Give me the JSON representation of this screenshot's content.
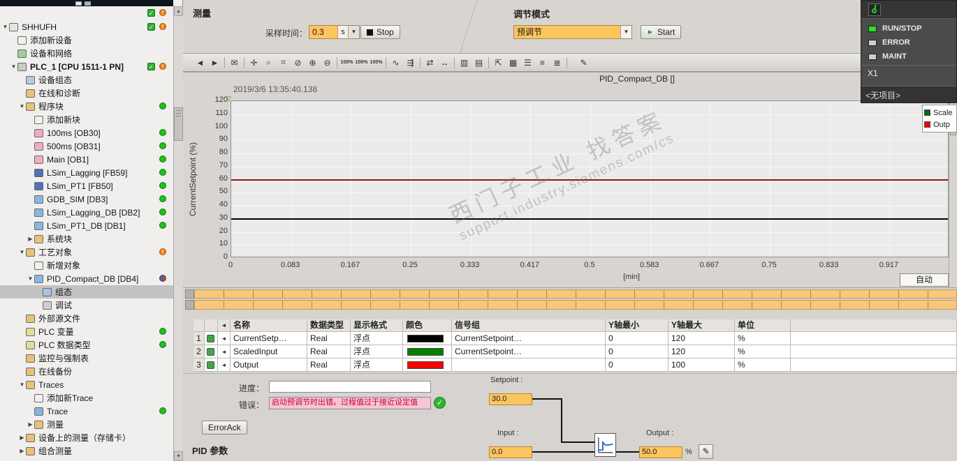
{
  "sidebar": {
    "items": [
      {
        "label": "SHHUFH",
        "level": 0,
        "arrow": "down",
        "icon": "project",
        "status": [
          "check",
          "warn"
        ]
      },
      {
        "label": "添加新设备",
        "level": 1,
        "icon": "add-device"
      },
      {
        "label": "设备和网络",
        "level": 1,
        "icon": "network"
      },
      {
        "label": "PLC_1 [CPU 1511-1 PN]",
        "level": 1,
        "arrow": "down",
        "icon": "plc",
        "status": [
          "check",
          "warn"
        ],
        "bold": true
      },
      {
        "label": "设备组态",
        "level": 2,
        "icon": "device-config"
      },
      {
        "label": "在线和诊断",
        "level": 2,
        "icon": "diagnostics"
      },
      {
        "label": "程序块",
        "level": 2,
        "arrow": "down",
        "icon": "folder-blocks",
        "status": [
          "green"
        ]
      },
      {
        "label": "添加新块",
        "level": 3,
        "icon": "add-block"
      },
      {
        "label": "100ms [OB30]",
        "level": 3,
        "icon": "ob",
        "status": [
          "green"
        ]
      },
      {
        "label": "500ms [OB31]",
        "level": 3,
        "icon": "ob",
        "status": [
          "green"
        ]
      },
      {
        "label": "Main [OB1]",
        "level": 3,
        "icon": "ob",
        "status": [
          "green"
        ]
      },
      {
        "label": "LSim_Lagging [FB59]",
        "level": 3,
        "icon": "fb",
        "status": [
          "green"
        ]
      },
      {
        "label": "LSim_PT1 [FB50]",
        "level": 3,
        "icon": "fb",
        "status": [
          "green"
        ]
      },
      {
        "label": "GDB_SIM [DB3]",
        "level": 3,
        "icon": "db",
        "status": [
          "green"
        ]
      },
      {
        "label": "LSim_Lagging_DB [DB2]",
        "level": 3,
        "icon": "db",
        "status": [
          "green"
        ]
      },
      {
        "label": "LSim_PT1_DB [DB1]",
        "level": 3,
        "icon": "db",
        "status": [
          "green"
        ]
      },
      {
        "label": "系统块",
        "level": 3,
        "arrow": "right",
        "icon": "folder-system"
      },
      {
        "label": "工艺对象",
        "level": 2,
        "arrow": "down",
        "icon": "folder-tech",
        "status": [
          "warn"
        ]
      },
      {
        "label": "新增对象",
        "level": 3,
        "icon": "add-object"
      },
      {
        "label": "PID_Compact_DB [DB4]",
        "level": 3,
        "arrow": "down",
        "icon": "pid-db",
        "status": [
          "half"
        ]
      },
      {
        "label": "组态",
        "level": 4,
        "icon": "config",
        "selected": true
      },
      {
        "label": "调试",
        "level": 4,
        "icon": "commissioning"
      },
      {
        "label": "外部源文件",
        "level": 2,
        "icon": "folder-ext"
      },
      {
        "label": "PLC 变量",
        "level": 2,
        "icon": "tags",
        "status": [
          "green"
        ]
      },
      {
        "label": "PLC 数据类型",
        "level": 2,
        "icon": "data-types",
        "status": [
          "green"
        ]
      },
      {
        "label": "监控与强制表",
        "level": 2,
        "icon": "folder-watch"
      },
      {
        "label": "在线备份",
        "level": 2,
        "icon": "folder-backup"
      },
      {
        "label": "Traces",
        "level": 2,
        "arrow": "down",
        "icon": "folder-traces"
      },
      {
        "label": "添加新Trace",
        "level": 3,
        "icon": "add-trace"
      },
      {
        "label": "Trace",
        "level": 3,
        "icon": "trace",
        "status": [
          "green"
        ]
      },
      {
        "label": "测量",
        "level": 3,
        "arrow": "right",
        "icon": "folder-meas"
      },
      {
        "label": "设备上的测量（存储卡）",
        "level": 2,
        "arrow": "right",
        "icon": "folder-card"
      },
      {
        "label": "组合测量",
        "level": 2,
        "arrow": "right",
        "icon": "folder-multi"
      }
    ]
  },
  "header": {
    "measure_title": "测量",
    "sampling_label": "采样时间：",
    "sampling_value": "0.3",
    "sampling_unit": "s",
    "stop_label": "Stop",
    "tuning_title": "调节模式",
    "tuning_value": "预调节",
    "start_label": "Start"
  },
  "toolbar": {
    "icons": [
      {
        "name": "back-icon",
        "glyph": "◄"
      },
      {
        "name": "forward-icon",
        "glyph": "►"
      },
      {
        "sep": true
      },
      {
        "name": "export-icon",
        "glyph": "✉"
      },
      {
        "sep": true
      },
      {
        "name": "pan-hand-icon",
        "glyph": "✛"
      },
      {
        "name": "zoom-select-icon",
        "glyph": "⌕"
      },
      {
        "name": "zoom-region-icon",
        "glyph": "⌗"
      },
      {
        "name": "zoom-undo-icon",
        "glyph": "⊘"
      },
      {
        "name": "zoom-in-icon",
        "glyph": "⊕"
      },
      {
        "name": "zoom-out-icon",
        "glyph": "⊖"
      },
      {
        "sep": true
      },
      {
        "name": "zoom-100-icon",
        "glyph": "100%"
      },
      {
        "name": "zoom-100-vertical-icon",
        "glyph": "100%"
      },
      {
        "name": "zoom-100-horizontal-icon",
        "glyph": "100%"
      },
      {
        "sep": true
      },
      {
        "name": "curve-mode-icon",
        "glyph": "∿"
      },
      {
        "name": "sample-mode-icon",
        "glyph": "⇶"
      },
      {
        "sep": true
      },
      {
        "name": "compress-view-icon",
        "glyph": "⇄"
      },
      {
        "name": "stretch-view-icon",
        "glyph": "↔"
      },
      {
        "sep": true
      },
      {
        "name": "vertical-split-icon",
        "glyph": "▥"
      },
      {
        "name": "horizontal-split-icon",
        "glyph": "▤"
      },
      {
        "sep": true
      },
      {
        "name": "move-view-icon",
        "glyph": "⇱"
      },
      {
        "name": "grid-toggle-icon",
        "glyph": "▦"
      },
      {
        "name": "legend-toggle-icon",
        "glyph": "☰"
      },
      {
        "name": "align-left-icon",
        "glyph": "≡"
      },
      {
        "name": "align-right-icon",
        "glyph": "≣"
      },
      {
        "sep": true
      },
      {
        "name": "snapshot-icon",
        "glyph": "✎"
      }
    ]
  },
  "chart_data": {
    "type": "line",
    "title": "PID_Compact_DB []",
    "timestamp": "2019/3/6 13:35:40.138",
    "ylabel": "CurrentSetpoint (%)",
    "xlabel": "[min]",
    "ylim": [
      0,
      120
    ],
    "yticks": [
      0,
      10,
      20,
      30,
      40,
      50,
      60,
      70,
      80,
      90,
      100,
      110,
      120
    ],
    "xticks": [
      "0",
      "0.083",
      "0.167",
      "0.25",
      "0.333",
      "0.417",
      "0.5",
      "0.583",
      "0.667",
      "0.75",
      "0.833",
      "0.917"
    ],
    "grid": true,
    "series": [
      {
        "name": "CurrentSetpoint",
        "color": "#000000",
        "value": 30,
        "axis": [
          0,
          120
        ],
        "shape": "constant-horizontal-line"
      },
      {
        "name": "ScaledInput",
        "color": "#1a7a1a",
        "value": 0,
        "axis": [
          0,
          120
        ],
        "shape": "constant-horizontal-line"
      },
      {
        "name": "Output",
        "color": "#8b1a1a",
        "value": 50,
        "axis": [
          0,
          100
        ],
        "shape": "constant-horizontal-line"
      }
    ],
    "legend": [
      {
        "label": "Scale",
        "color": "#0a6b0a"
      },
      {
        "label": "Outp",
        "color": "#ff0000"
      }
    ],
    "legend_position": "top-right"
  },
  "chart_ui": {
    "auto_label": "自动"
  },
  "watermark": {
    "line1": "西门子工业  找答案",
    "line2": "support.industry.siemens.com/cs"
  },
  "table": {
    "headers": [
      "",
      "",
      "◄",
      "名称",
      "数据类型",
      "显示格式",
      "颜色",
      "信号组",
      "Y轴最小",
      "Y轴最大",
      "单位",
      ""
    ],
    "rows": [
      {
        "num": "1",
        "name": "CurrentSetp…",
        "dtype": "Real",
        "format": "浮点",
        "color": "#000000",
        "group": "CurrentSetpoint…",
        "ymin": "0",
        "ymax": "120",
        "unit": "%"
      },
      {
        "num": "2",
        "name": "ScaledInput",
        "dtype": "Real",
        "format": "浮点",
        "color": "#008000",
        "group": "CurrentSetpoint…",
        "ymin": "0",
        "ymax": "120",
        "unit": "%"
      },
      {
        "num": "3",
        "name": "Output",
        "dtype": "Real",
        "format": "浮点",
        "color": "#ff0000",
        "group": "",
        "ymin": "0",
        "ymax": "100",
        "unit": "%"
      }
    ]
  },
  "status_panel": {
    "setpoint_label": "Setpoint :",
    "setpoint_value": "30.0",
    "progress_label": "进度：",
    "progress_value": "",
    "error_label": "错误：",
    "error_text": "启动预调节时出错。过程值过于接近设定值",
    "error_ack": "ErrorAck",
    "pid_title": "PID 参数",
    "input_label": "Input :",
    "input_value": "0.0",
    "output_label": "Output :",
    "output_value": "50.0",
    "output_unit": "%"
  },
  "cpu_panel": {
    "leds": [
      {
        "label": "RUN/STOP",
        "color": "#28e228"
      },
      {
        "label": "ERROR",
        "color": "#cfcfcf"
      },
      {
        "label": "MAINT",
        "color": "#cfcfcf"
      }
    ],
    "interface": "X1",
    "no_project": "<无项目>"
  }
}
